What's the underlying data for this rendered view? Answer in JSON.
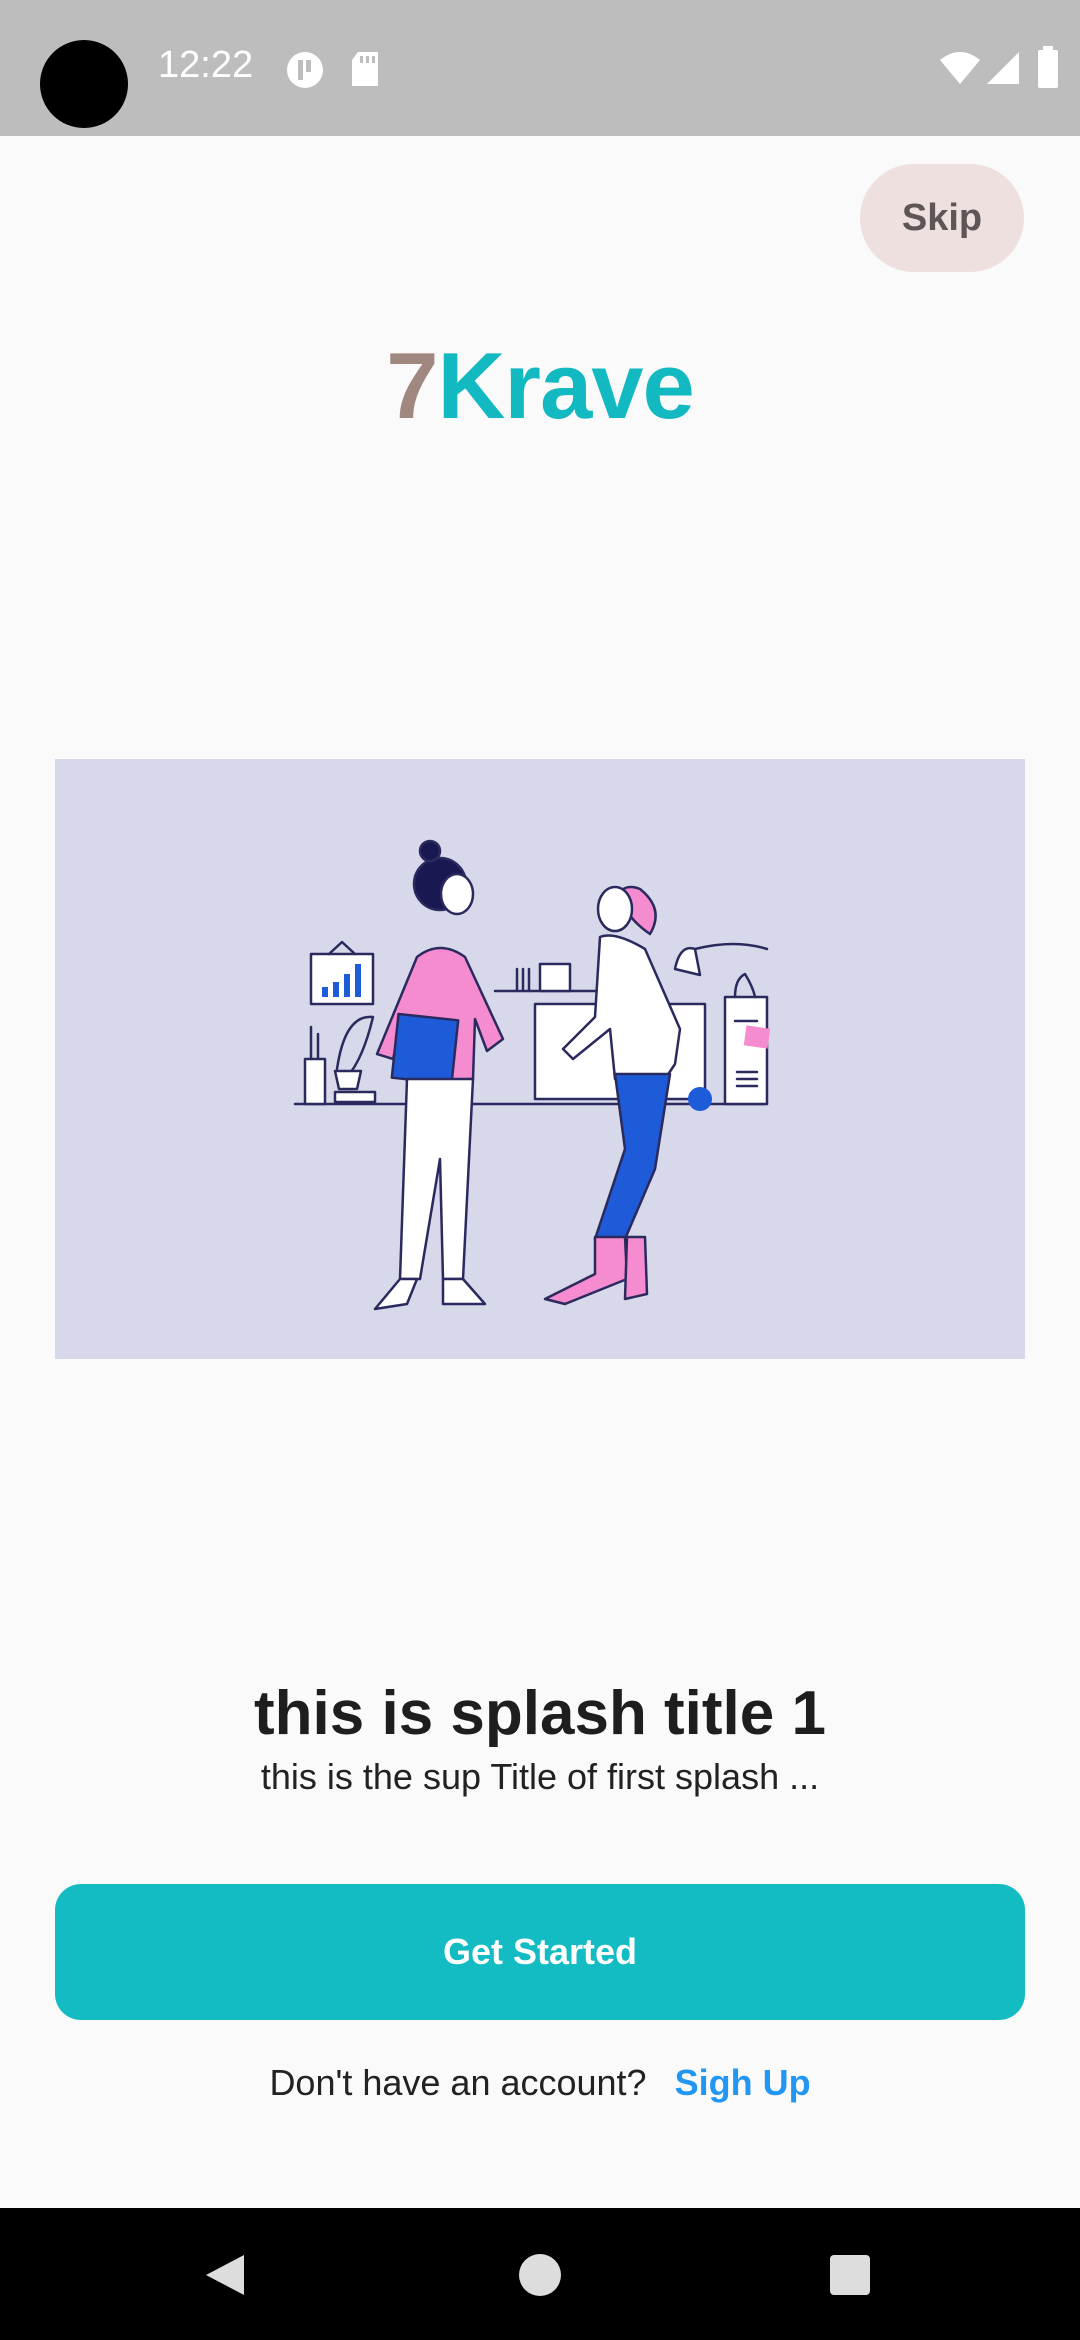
{
  "status_bar": {
    "time": "12:22",
    "icons": [
      "camera-cutout",
      "app-notification-icon",
      "sd-card-icon",
      "wifi-icon",
      "signal-icon",
      "battery-icon"
    ]
  },
  "header": {
    "skip_label": "Skip"
  },
  "logo": {
    "part1": "7",
    "part2": "Krave",
    "color1": "#a08880",
    "color2": "#13b9c0"
  },
  "splash": {
    "title": "this is splash title 1",
    "subtitle": "this is the sup Title of first splash ...",
    "illustration": "two-women-office-illustration"
  },
  "actions": {
    "get_started_label": "Get Started",
    "no_account_text": "Don't have an account?",
    "signup_label": "Sigh Up",
    "accent": "#13bcc3",
    "link_color": "#2196f3"
  },
  "nav_bar": {
    "buttons": [
      "back-icon",
      "home-icon",
      "recents-icon"
    ]
  }
}
